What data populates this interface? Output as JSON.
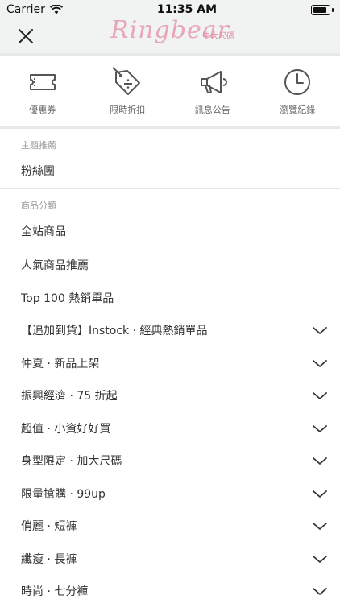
{
  "status_bar": {
    "carrier": "Carrier",
    "time": "11:35 AM"
  },
  "header": {
    "logo_text": "Ringbear",
    "logo_sub": "中大尺碼"
  },
  "quick_links": [
    {
      "label": "優惠券",
      "icon": "ticket-icon"
    },
    {
      "label": "限時折扣",
      "icon": "discount-tag-icon"
    },
    {
      "label": "訊息公告",
      "icon": "megaphone-icon"
    },
    {
      "label": "瀏覽紀錄",
      "icon": "clock-icon"
    }
  ],
  "theme_section": {
    "title": "主題推薦",
    "items": [
      "粉絲團"
    ]
  },
  "category_section": {
    "title": "商品分類",
    "items": [
      {
        "label": "全站商品",
        "expandable": false
      },
      {
        "label": "人氣商品推薦",
        "expandable": false
      },
      {
        "label": "Top 100 熱銷單品",
        "expandable": false
      },
      {
        "label": "【追加到貨】Instock · 經典熱銷單品",
        "expandable": true
      },
      {
        "label": "仲夏 · 新品上架",
        "expandable": true
      },
      {
        "label": "振興經濟 · 75 折起",
        "expandable": true
      },
      {
        "label": "超值 · 小資好好買",
        "expandable": true
      },
      {
        "label": "身型限定 · 加大尺碼",
        "expandable": true
      },
      {
        "label": "限量搶購 · 99up",
        "expandable": true
      },
      {
        "label": "俏麗 · 短褲",
        "expandable": true
      },
      {
        "label": "纖瘦 · 長褲",
        "expandable": true
      },
      {
        "label": "時尚 · 七分褲",
        "expandable": true
      }
    ]
  }
}
